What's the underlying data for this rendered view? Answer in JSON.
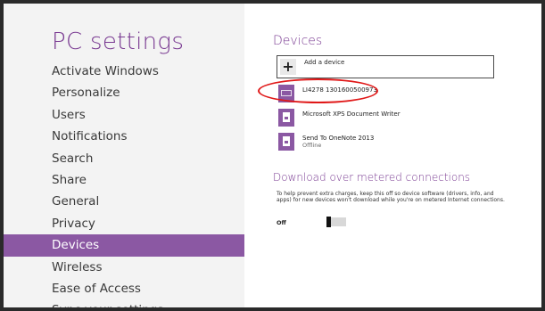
{
  "sidebar": {
    "title": "PC settings",
    "items": [
      {
        "label": "Activate Windows"
      },
      {
        "label": "Personalize"
      },
      {
        "label": "Users"
      },
      {
        "label": "Notifications"
      },
      {
        "label": "Search"
      },
      {
        "label": "Share"
      },
      {
        "label": "General"
      },
      {
        "label": "Privacy"
      },
      {
        "label": "Devices",
        "selected": true
      },
      {
        "label": "Wireless"
      },
      {
        "label": "Ease of Access"
      },
      {
        "label": "Sync your settings"
      }
    ]
  },
  "devices": {
    "title": "Devices",
    "add_label": "Add a device",
    "list": [
      {
        "name": "LI4278 1301600500973",
        "status": "",
        "icon": "keyboard-icon"
      },
      {
        "name": "Microsoft XPS Document Writer",
        "status": "",
        "icon": "printer-icon"
      },
      {
        "name": "Send To OneNote 2013",
        "status": "Offline",
        "icon": "printer-icon"
      }
    ]
  },
  "metered": {
    "title": "Download over metered connections",
    "description": "To help prevent extra charges, keep this off so device software (drivers, info, and apps) for new devices won't download while you're on metered Internet connections.",
    "toggle_label": "Off"
  },
  "colors": {
    "accent": "#8b58a3",
    "title": "#7a3b92",
    "highlight": "#e01818"
  }
}
